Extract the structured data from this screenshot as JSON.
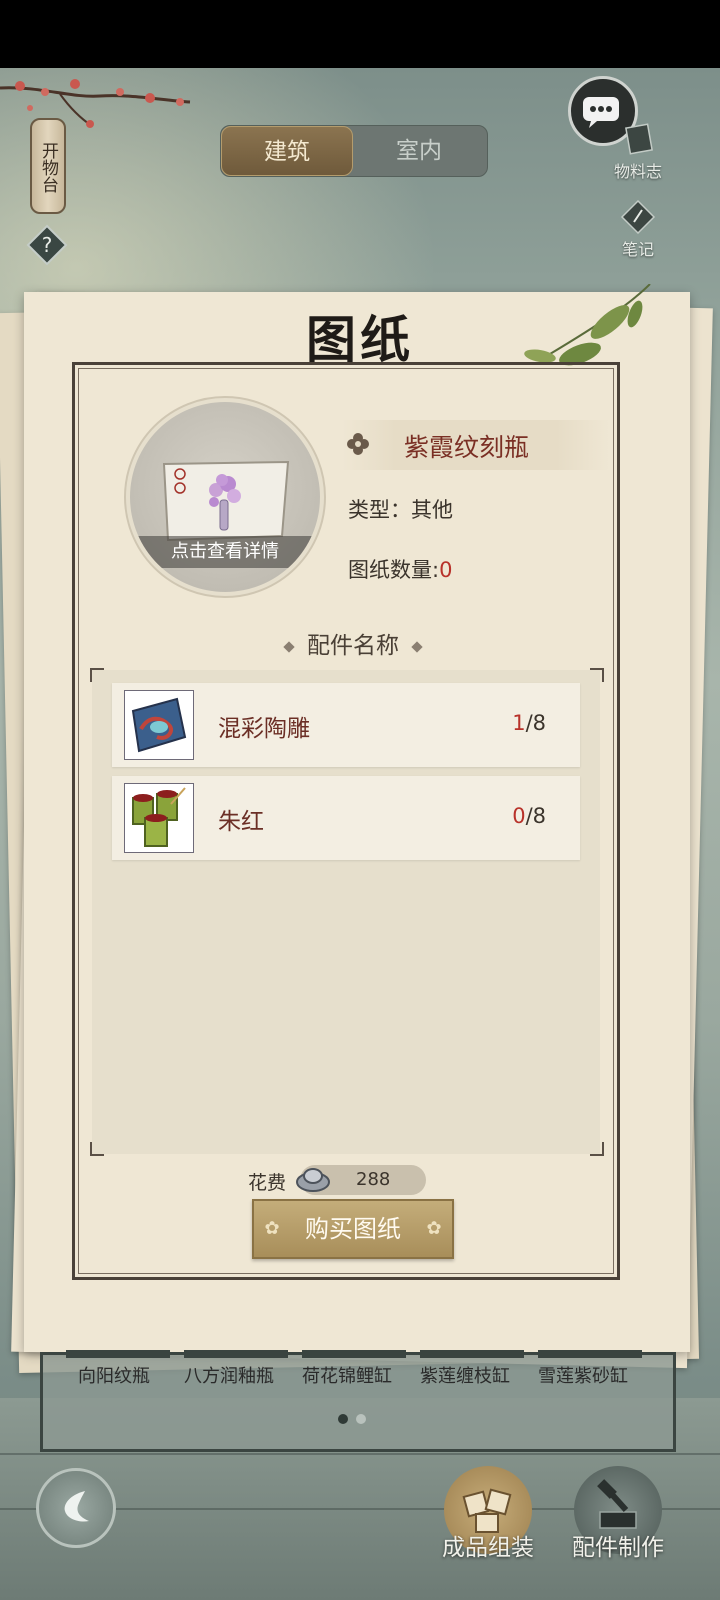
{
  "header": {
    "sign_label": "开物台",
    "help_icon": "question-diamond-icon",
    "tabs": [
      {
        "label": "建筑",
        "active": true
      },
      {
        "label": "室内",
        "active": false
      }
    ],
    "side_menu": [
      {
        "label": "物料志",
        "icon": "book-icon"
      },
      {
        "label": "笔记",
        "icon": "note-icon"
      }
    ],
    "chat_icon": "chat-bubble-icon"
  },
  "blueprint": {
    "title": "图纸",
    "thumbnail_caption": "点击查看详情",
    "item_name": "紫霞纹刻瓶",
    "type_label": "类型：",
    "type_value": "其他",
    "count_label": "图纸数量:",
    "count_value": "0",
    "parts_section_title": "配件名称",
    "parts": [
      {
        "name": "混彩陶雕",
        "owned": "1",
        "required": "/8",
        "icon": "blue-carved-tile-icon"
      },
      {
        "name": "朱红",
        "owned": "0",
        "required": "/8",
        "icon": "bamboo-paint-cups-icon"
      }
    ],
    "cost_label": "花费",
    "cost_value": "288",
    "cost_icon": "silver-ingot-icon",
    "buy_button": "购买图纸"
  },
  "shelf": {
    "items": [
      "向阳纹瓶",
      "八方润釉瓶",
      "荷花锦鲤缸",
      "紫莲缠枝缸",
      "雪莲紫砂缸"
    ],
    "page_dots": [
      true,
      false
    ]
  },
  "bottom_nav": {
    "back_icon": "back-arrow-icon",
    "buttons": [
      {
        "label": "成品组装",
        "icon": "assemble-icon"
      },
      {
        "label": "配件制作",
        "icon": "craft-icon"
      }
    ]
  },
  "colors": {
    "accent_red": "#b8322a",
    "tab_active": "#8b7450",
    "paper": "#efe7d4",
    "part_name": "#6b2e25"
  }
}
